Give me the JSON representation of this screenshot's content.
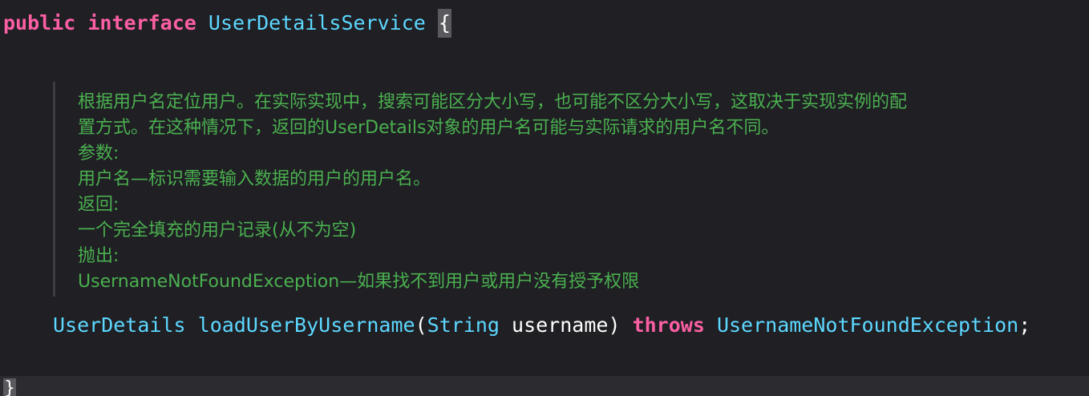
{
  "code": {
    "line1": {
      "kw_public": "public",
      "kw_interface": "interface",
      "type_name": "UserDetailsService",
      "open_brace": "{"
    },
    "doc_comment": {
      "lines": [
        "根据用户名定位用户。在实际实现中，搜索可能区分大小写，也可能不区分大小写，这取决于实现实例的配",
        "置方式。在这种情况下，返回的UserDetails对象的用户名可能与实际请求的用户名不同。",
        "参数:",
        "用户名—标识需要输入数据的用户的用户名。",
        "返回:",
        "一个完全填充的用户记录(从不为空)",
        "抛出:",
        "UsernameNotFoundException—如果找不到用户或用户没有授予权限"
      ]
    },
    "method": {
      "return_type": "UserDetails",
      "name": "loadUserByUsername",
      "open_paren": "(",
      "param_type": "String",
      "param_name": "username",
      "close_paren": ")",
      "kw_throws": "throws",
      "exception_type": "UsernameNotFoundException",
      "semicolon": ";"
    },
    "closing_brace": "}"
  },
  "colors": {
    "background": "#1f1f24",
    "keyword": "#fc5fa3",
    "type": "#5dd8ff",
    "plain": "#ffffff",
    "doc_comment": "#4bb04f",
    "current_line": "#2b2b30"
  }
}
